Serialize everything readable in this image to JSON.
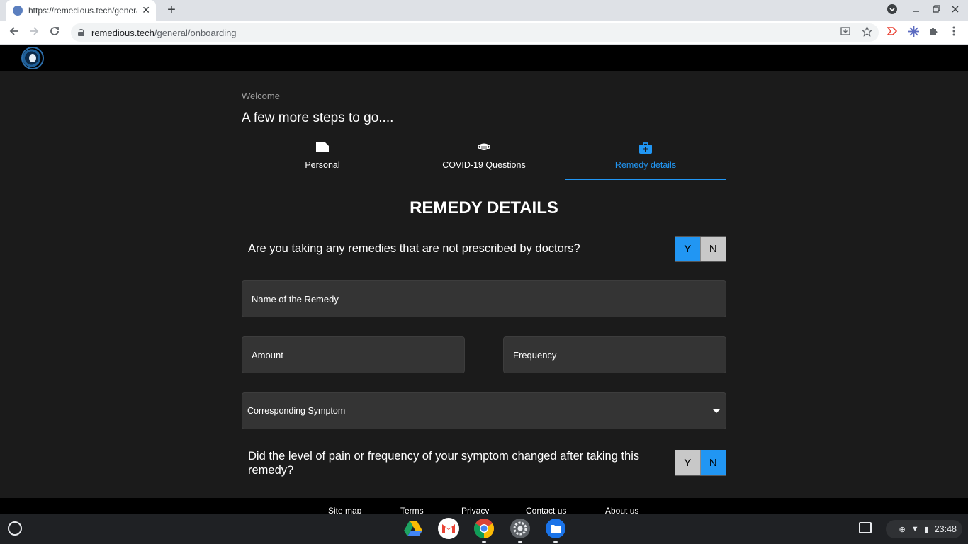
{
  "browser": {
    "tab_title": "https://remedious.tech/general/onboarding",
    "tab_close": "✕",
    "new_tab": "+",
    "url_domain": "remedious.tech",
    "url_path": "/general/onboarding"
  },
  "page": {
    "welcome": "Welcome",
    "headline": "A few more steps to go....",
    "steps": [
      {
        "label": "Personal"
      },
      {
        "label": "COVID-19 Questions"
      },
      {
        "label": "Remedy details"
      }
    ],
    "section_title": "REMEDY DETAILS",
    "q1": {
      "text": "Are you taking any remedies that are not prescribed by doctors?",
      "yes": "Y",
      "no": "N",
      "selected": "Y"
    },
    "remedy_name_placeholder": "Name of the Remedy",
    "amount_placeholder": "Amount",
    "frequency_placeholder": "Frequency",
    "symptom_select": "Corresponding Symptom",
    "q2": {
      "text": "Did the level of pain or frequency of your symptom changed after taking this remedy?",
      "yes": "Y",
      "no": "N",
      "selected": "N"
    },
    "colors": {
      "accent": "#2196f3",
      "background": "#1b1b1b",
      "field": "#343434"
    }
  },
  "footer": {
    "links": [
      "Site map",
      "Terms",
      "Privacy",
      "Contact us",
      "About us"
    ]
  },
  "shelf": {
    "time": "23:48"
  }
}
